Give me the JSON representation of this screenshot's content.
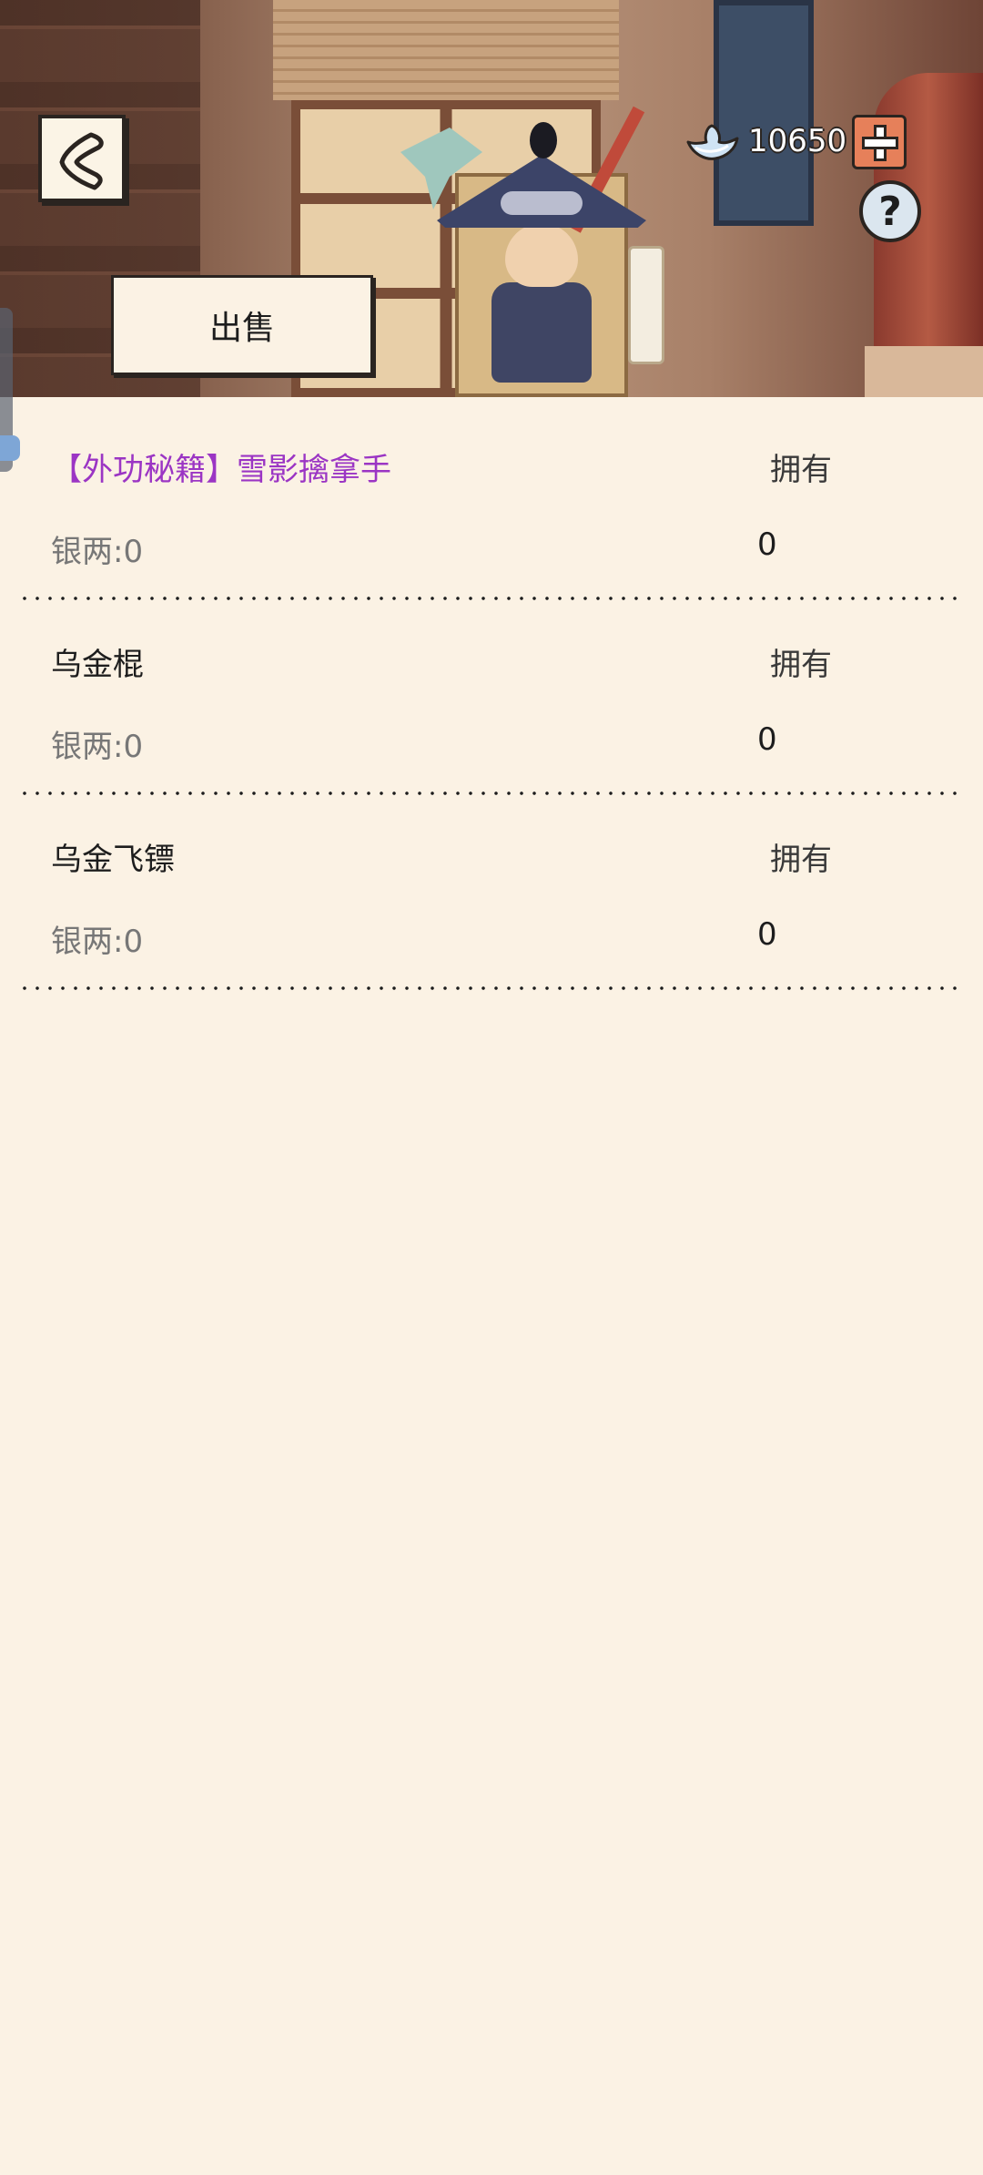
{
  "header": {
    "sell_label": "出售",
    "currency_value": "10650",
    "help_label": "?"
  },
  "icons": {
    "back": "back-chevron-icon",
    "currency": "silver-ingot-icon",
    "add": "plus-icon",
    "help": "question-icon"
  },
  "items": [
    {
      "name": "【外功秘籍】雪影擒拿手",
      "owned_label": "拥有",
      "price": "银两:0",
      "count": "0",
      "name_color": "#9b35c4"
    },
    {
      "name": "乌金棍",
      "owned_label": "拥有",
      "price": "银两:0",
      "count": "0"
    },
    {
      "name": "乌金飞镖",
      "owned_label": "拥有",
      "price": "银两:0",
      "count": "0"
    }
  ]
}
